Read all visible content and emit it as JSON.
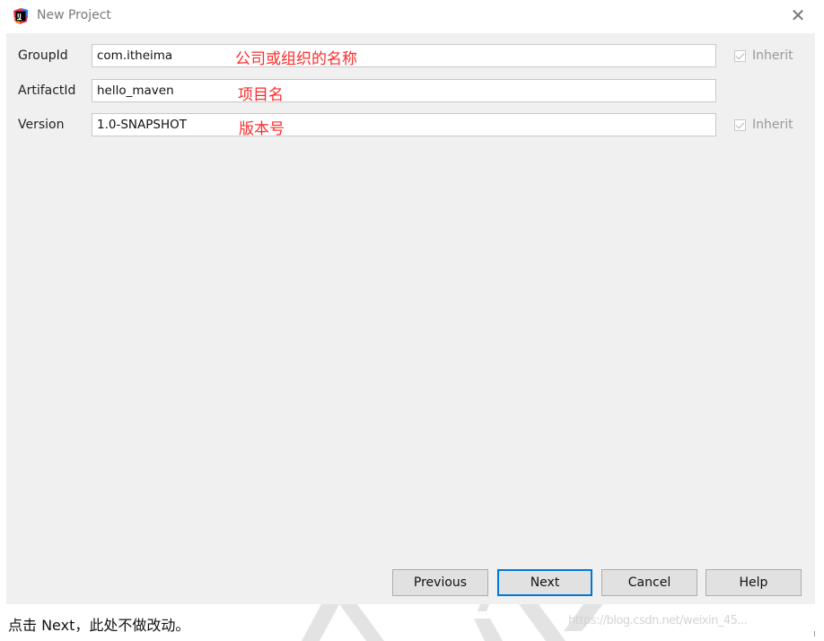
{
  "window": {
    "title": "New Project",
    "app_icon": "intellij-idea-icon",
    "close_icon": "close-icon",
    "close_glyph": "✕"
  },
  "form": {
    "rows": [
      {
        "label": "GroupId",
        "value": "com.itheima",
        "annotation": "公司或组织的名称",
        "inherit": {
          "label": "Inherit",
          "checked": true
        }
      },
      {
        "label": "ArtifactId",
        "value": "hello_maven",
        "annotation": "项目名"
      },
      {
        "label": "Version",
        "value": "1.0-SNAPSHOT",
        "annotation": "版本号",
        "inherit": {
          "label": "Inherit",
          "checked": true
        }
      }
    ]
  },
  "buttons": {
    "previous": "Previous",
    "next": "Next",
    "cancel": "Cancel",
    "help": "Help"
  },
  "caption": "点击 Next，此处不做改动。",
  "watermark": "https://blog.csdn.net/weixin_45...",
  "colors": {
    "annotation": "#ff2a2a",
    "default_button_border": "#0078d7",
    "dialog_bg": "#f0f0f0"
  }
}
